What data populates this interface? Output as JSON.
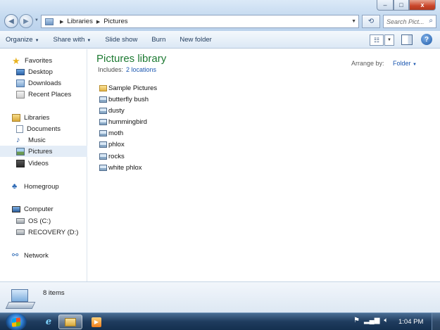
{
  "window": {
    "address": {
      "segments": [
        "Libraries",
        "Pictures"
      ]
    },
    "search_placeholder": "Search Pict...",
    "controls": {
      "minimize": "–",
      "maximize": "□",
      "close": "x"
    }
  },
  "toolbar": {
    "organize": "Organize",
    "share_with": "Share with",
    "slide_show": "Slide show",
    "burn": "Burn",
    "new_folder": "New folder"
  },
  "sidebar": {
    "favorites": "Favorites",
    "desktop": "Desktop",
    "downloads": "Downloads",
    "recent_places": "Recent Places",
    "libraries": "Libraries",
    "documents": "Documents",
    "music": "Music",
    "pictures": "Pictures",
    "videos": "Videos",
    "homegroup": "Homegroup",
    "computer": "Computer",
    "os_drive": "OS (C:)",
    "recovery_drive": "RECOVERY (D:)",
    "network": "Network"
  },
  "main": {
    "title": "Pictures library",
    "includes_label": "Includes:",
    "includes_link": "2 locations",
    "arrange_by_label": "Arrange by:",
    "arrange_by_value": "Folder",
    "files": [
      {
        "name": "Sample Pictures",
        "type": "folder"
      },
      {
        "name": "butterfly bush",
        "type": "image"
      },
      {
        "name": "dusty",
        "type": "image"
      },
      {
        "name": "hummingbird",
        "type": "image"
      },
      {
        "name": "moth",
        "type": "image"
      },
      {
        "name": "phlox",
        "type": "image"
      },
      {
        "name": "rocks",
        "type": "image"
      },
      {
        "name": "white phlox",
        "type": "image"
      }
    ]
  },
  "details": {
    "item_count": "8 items"
  },
  "taskbar": {
    "clock": "1:04 PM"
  },
  "icons": {
    "favorites": "star-icon",
    "homegroup": "homegroup-icon",
    "network": "network-icon",
    "help": "help-icon"
  },
  "colors": {
    "library_title": "#1d7a32",
    "link": "#1a56b0",
    "selection": "#e4edf7",
    "taskbar": "#1f3c5e"
  }
}
